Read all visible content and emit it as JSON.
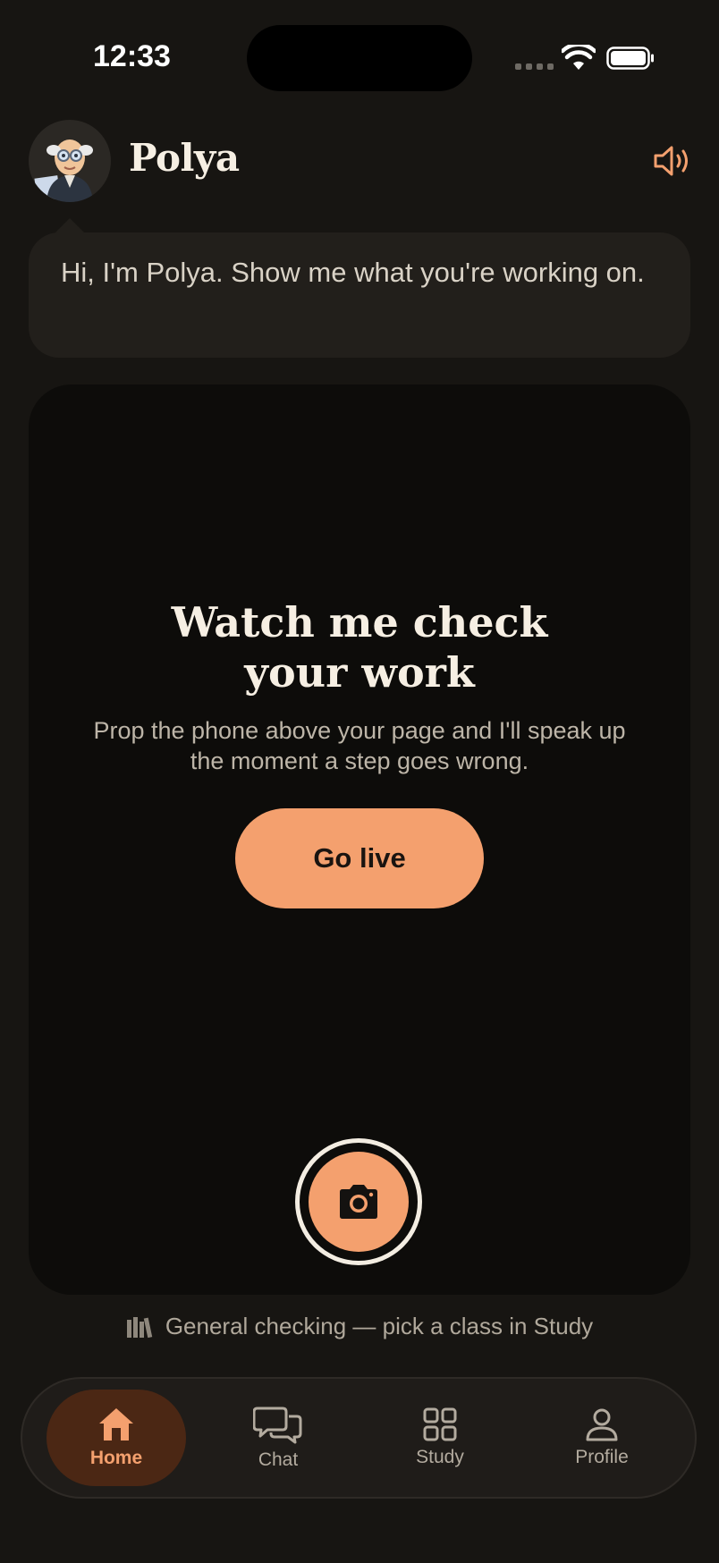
{
  "status_bar": {
    "time": "12:33"
  },
  "header": {
    "app_name": "Polya",
    "speaker_icon": "speaker-volume-icon",
    "avatar": "polya-avatar"
  },
  "bubble": {
    "text": "Hi, I'm Polya. Show me what you're working on."
  },
  "card": {
    "title_line1": "Watch me check",
    "title_line2": "your work",
    "subtitle": "Prop the phone above your page and I'll speak up the moment a step goes wrong.",
    "go_live_label": "Go live",
    "shutter_icon": "camera-icon"
  },
  "context": {
    "icon": "books-icon",
    "text": "General checking — pick a class in Study"
  },
  "tabs": [
    {
      "label": "Home",
      "icon": "house-icon",
      "active": true
    },
    {
      "label": "Chat",
      "icon": "chat-bubbles-icon",
      "active": false
    },
    {
      "label": "Study",
      "icon": "grid-icon",
      "active": false
    },
    {
      "label": "Profile",
      "icon": "person-icon",
      "active": false
    }
  ],
  "colors": {
    "background": "#171512",
    "accent": "#f4a06e",
    "active_tab_bg": "#4b2714",
    "card": "#0d0c0a",
    "bubble": "#221f1b"
  }
}
